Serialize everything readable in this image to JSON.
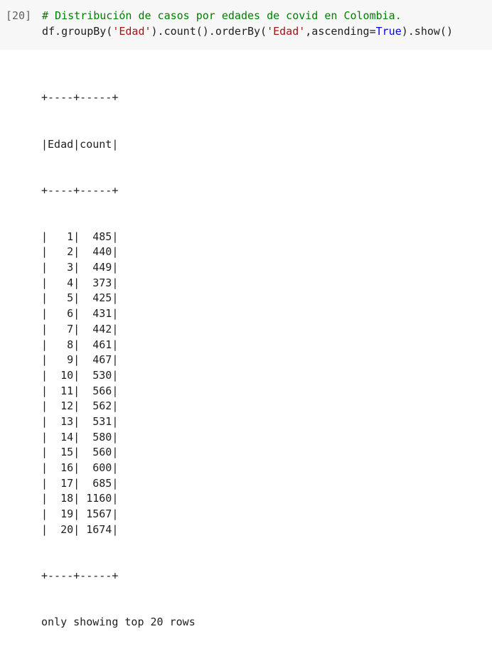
{
  "cell": {
    "prompt": "[20]",
    "code_lines": [
      [
        {
          "cls": "c-comment",
          "text": "# Distribución de casos por edades de covid en Colombia."
        }
      ],
      [
        {
          "cls": "c-plain",
          "text": "df.groupBy("
        },
        {
          "cls": "c-string",
          "text": "'Edad'"
        },
        {
          "cls": "c-plain",
          "text": ").count().orderBy("
        },
        {
          "cls": "c-string",
          "text": "'Edad'"
        },
        {
          "cls": "c-plain",
          "text": ",ascending="
        },
        {
          "cls": "c-kw",
          "text": "True"
        },
        {
          "cls": "c-plain",
          "text": ").show()"
        }
      ]
    ]
  },
  "output": {
    "border": "+----+-----+",
    "header": "|Edad|count|",
    "rows": [
      {
        "edad": "1",
        "count": "485"
      },
      {
        "edad": "2",
        "count": "440"
      },
      {
        "edad": "3",
        "count": "449"
      },
      {
        "edad": "4",
        "count": "373"
      },
      {
        "edad": "5",
        "count": "425"
      },
      {
        "edad": "6",
        "count": "431"
      },
      {
        "edad": "7",
        "count": "442"
      },
      {
        "edad": "8",
        "count": "461"
      },
      {
        "edad": "9",
        "count": "467"
      },
      {
        "edad": "10",
        "count": "530"
      },
      {
        "edad": "11",
        "count": "566"
      },
      {
        "edad": "12",
        "count": "562"
      },
      {
        "edad": "13",
        "count": "531"
      },
      {
        "edad": "14",
        "count": "580"
      },
      {
        "edad": "15",
        "count": "560"
      },
      {
        "edad": "16",
        "count": "600"
      },
      {
        "edad": "17",
        "count": "685"
      },
      {
        "edad": "18",
        "count": "1160"
      },
      {
        "edad": "19",
        "count": "1567"
      },
      {
        "edad": "20",
        "count": "1674"
      }
    ],
    "footer": "only showing top 20 rows"
  }
}
